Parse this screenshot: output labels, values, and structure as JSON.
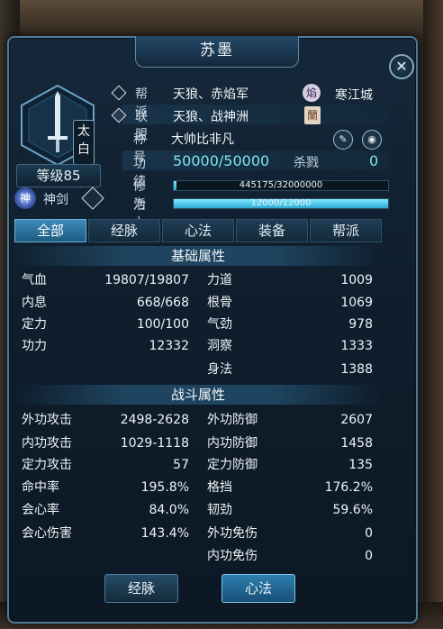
{
  "window": {
    "title": "苏墨",
    "close_label": "✕"
  },
  "avatar": {
    "school_badge": "太白",
    "level": "等级85",
    "class_icon_text": "神",
    "class_name": "神剑"
  },
  "info": {
    "faction_label": "帮派",
    "faction_value": "天狼、赤焰军",
    "faction_icon": "焰",
    "city": "寒江城",
    "alliance_label": "联盟",
    "alliance_value": "天狼、战神洲",
    "alliance_icon": "蘭",
    "title_label": "称号",
    "title_value": "大帅比非凡",
    "merit_label": "功绩",
    "merit_value": "50000/50000",
    "kill_label": "杀戮",
    "kill_value": "0",
    "cultivation_label": "修为",
    "cultivation_text": "445175/32000000",
    "cultivation_fraction": 0.0139,
    "vitality_label": "活力",
    "vitality_text": "12000/12000",
    "vitality_fraction": 1.0
  },
  "tabs": [
    "全部",
    "经脉",
    "心法",
    "装备",
    "帮派"
  ],
  "basic_attrs": {
    "header": "基础属性",
    "left": [
      {
        "k": "气血",
        "v": "19807/19807"
      },
      {
        "k": "内息",
        "v": "668/668"
      },
      {
        "k": "定力",
        "v": "100/100"
      },
      {
        "k": "功力",
        "v": "12332"
      }
    ],
    "right": [
      {
        "k": "力道",
        "v": "1009"
      },
      {
        "k": "根骨",
        "v": "1069"
      },
      {
        "k": "气劲",
        "v": "978"
      },
      {
        "k": "洞察",
        "v": "1333"
      },
      {
        "k": "身法",
        "v": "1388"
      }
    ]
  },
  "combat_attrs": {
    "header": "战斗属性",
    "left": [
      {
        "k": "外功攻击",
        "v": "2498-2628"
      },
      {
        "k": "内功攻击",
        "v": "1029-1118"
      },
      {
        "k": "定力攻击",
        "v": "57"
      },
      {
        "k": "命中率",
        "v": "195.8%"
      },
      {
        "k": "会心率",
        "v": "84.0%"
      },
      {
        "k": "会心伤害",
        "v": "143.4%"
      }
    ],
    "right": [
      {
        "k": "外功防御",
        "v": "2607"
      },
      {
        "k": "内功防御",
        "v": "1458"
      },
      {
        "k": "定力防御",
        "v": "135"
      },
      {
        "k": "格挡",
        "v": "176.2%"
      },
      {
        "k": "韧劲",
        "v": "59.6%"
      },
      {
        "k": "外功免伤",
        "v": "0"
      },
      {
        "k": "内功免伤",
        "v": "0"
      }
    ]
  },
  "bottom_buttons": [
    "经脉",
    "心法"
  ]
}
